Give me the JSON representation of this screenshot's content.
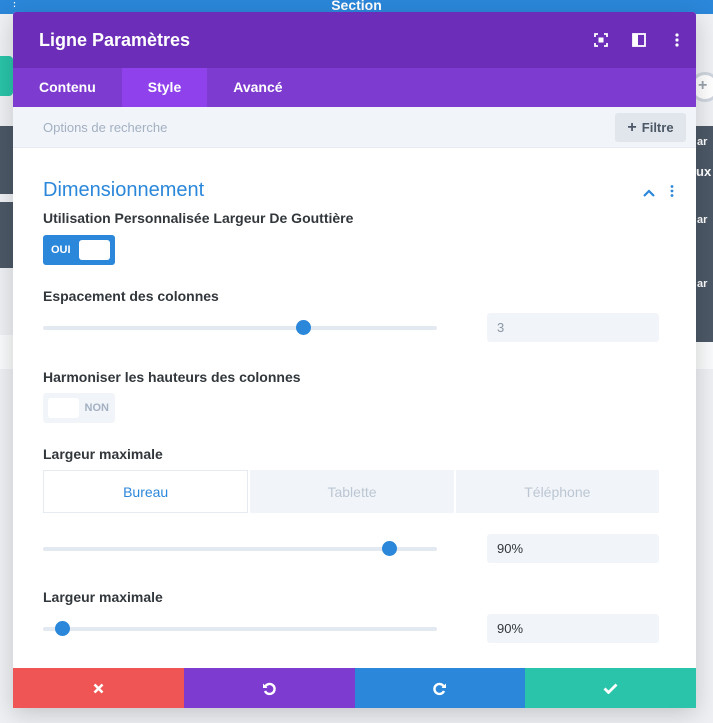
{
  "background": {
    "section_label": "Section",
    "right_edge_labels": [
      "ar",
      "ux",
      "ar",
      "ar"
    ]
  },
  "modal": {
    "title": "Ligne Paramètres",
    "header_icons": [
      "fullscreen-icon",
      "split-view-icon",
      "more-options-icon"
    ],
    "tabs": [
      {
        "label": "Contenu",
        "active": false
      },
      {
        "label": "Style",
        "active": true
      },
      {
        "label": "Avancé",
        "active": false
      }
    ],
    "search": {
      "placeholder": "Options de recherche"
    },
    "filter_button": {
      "label": "Filtre",
      "icon": "plus-icon"
    },
    "section": {
      "title": "Dimensionnement",
      "expanded": true
    },
    "fields": {
      "custom_gutter": {
        "label": "Utilisation Personnalisée Largeur De Gouttière",
        "toggle_label": "OUI",
        "value": true
      },
      "column_spacing": {
        "label": "Espacement des colonnes",
        "value": "3",
        "slider_fraction": 0.66
      },
      "equalize_heights": {
        "label": "Harmoniser les hauteurs des colonnes",
        "toggle_label": "NON",
        "value": false
      },
      "max_width_1": {
        "label": "Largeur maximale",
        "value": "90%",
        "slider_fraction": 0.88
      },
      "max_width_2": {
        "label": "Largeur maximale",
        "value": "90%",
        "slider_fraction": 0.05
      }
    },
    "device_tabs": [
      {
        "label": "Bureau",
        "active": true
      },
      {
        "label": "Tablette",
        "active": false
      },
      {
        "label": "Téléphone",
        "active": false
      }
    ],
    "footer_buttons": [
      {
        "name": "cancel",
        "icon": "close-icon",
        "color": "#ef5555"
      },
      {
        "name": "undo",
        "icon": "undo-icon",
        "color": "#7e3bd0"
      },
      {
        "name": "redo",
        "icon": "redo-icon",
        "color": "#2b87da"
      },
      {
        "name": "save",
        "icon": "check-icon",
        "color": "#29c4a9"
      }
    ]
  },
  "colors": {
    "header": "#6c2eb9",
    "tabs": "#7e3bd0",
    "active_tab": "#8f42ec",
    "accent": "#2b87da"
  }
}
